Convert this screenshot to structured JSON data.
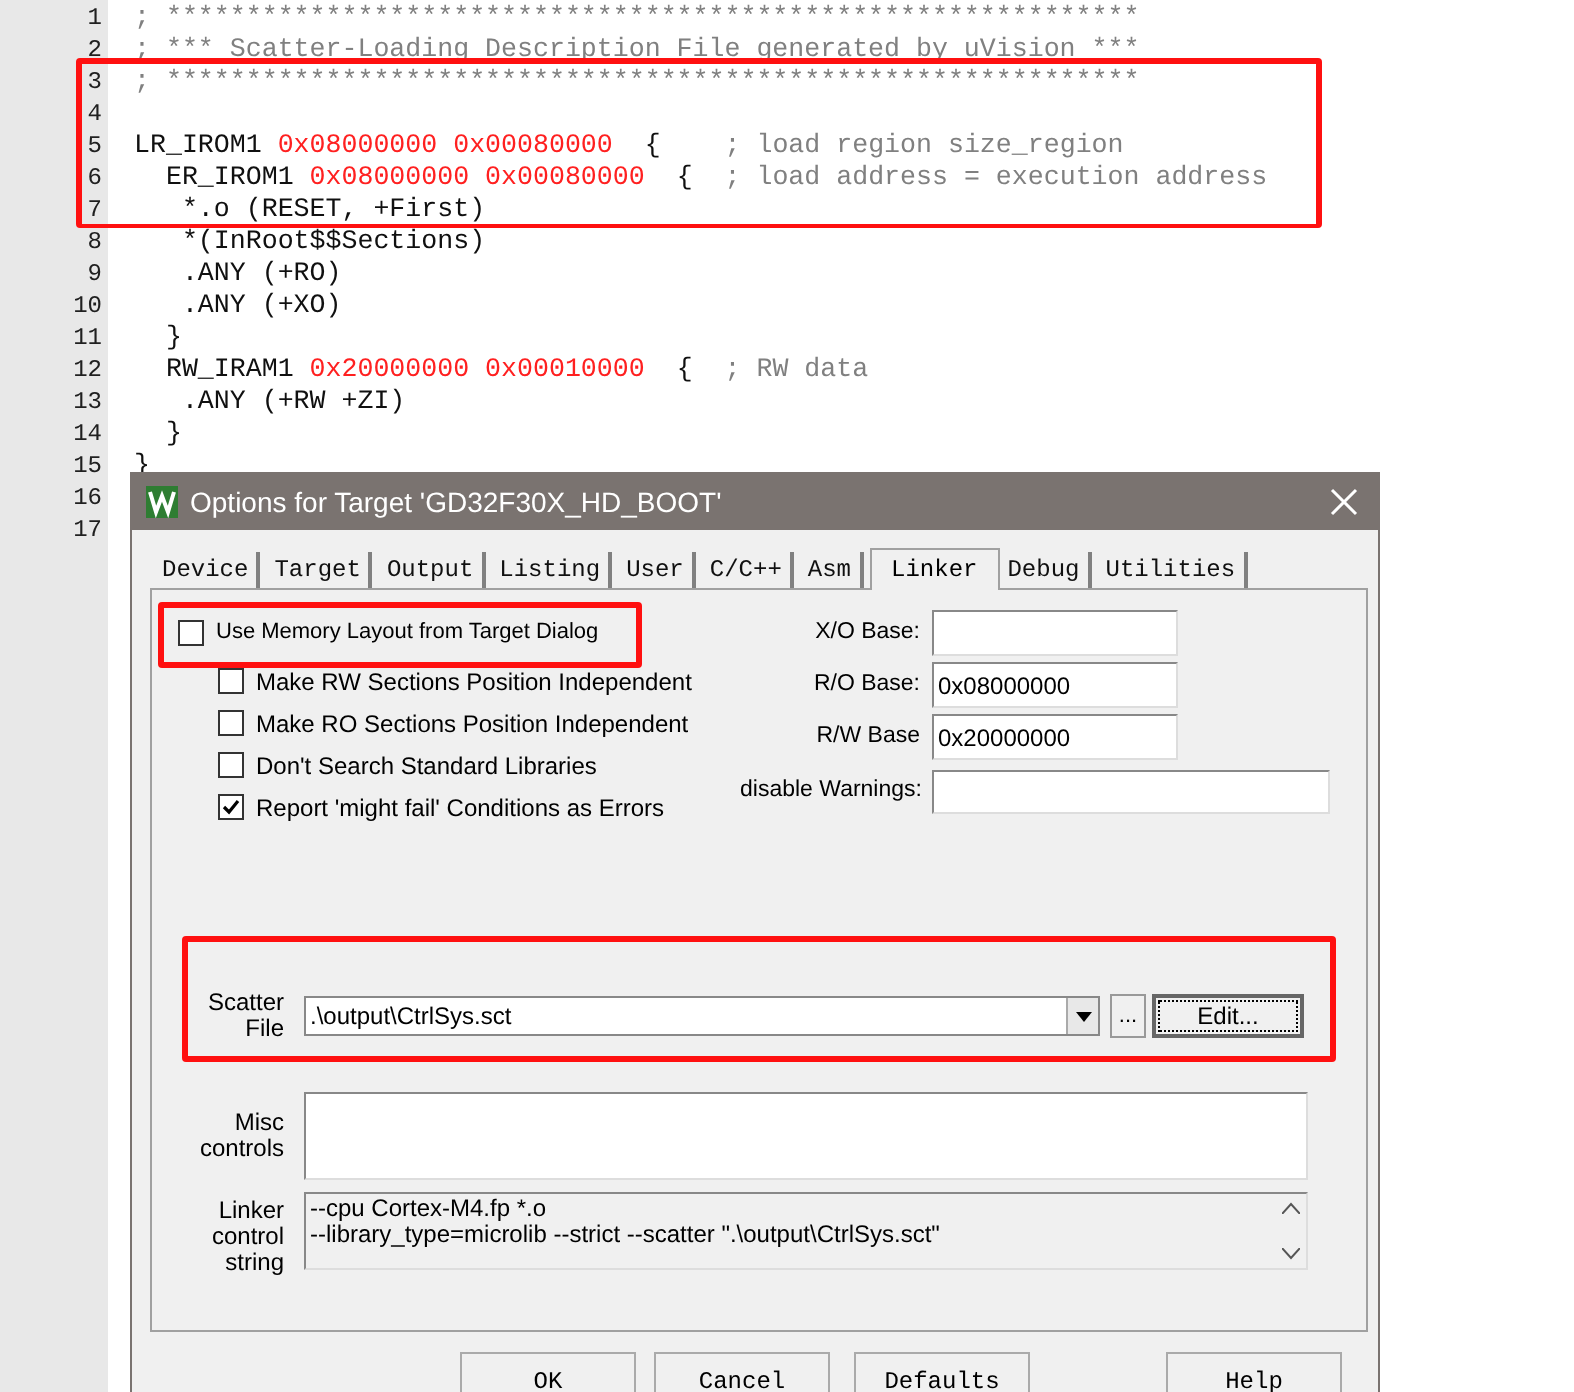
{
  "editor": {
    "lines": [
      {
        "number": "1",
        "segments": [
          {
            "kind": "comment",
            "text": "; *************************************************************"
          }
        ]
      },
      {
        "number": "2",
        "segments": [
          {
            "kind": "comment",
            "text": "; *** Scatter-Loading Description File generated by uVision ***"
          }
        ]
      },
      {
        "number": "3",
        "segments": [
          {
            "kind": "comment",
            "text": "; *************************************************************"
          }
        ]
      },
      {
        "number": "4"
      },
      {
        "number": "5",
        "segments": [
          {
            "kind": "code",
            "text": "LR_IROM1 "
          },
          {
            "kind": "number",
            "text": "0x08000000 0x00080000"
          },
          {
            "kind": "code",
            "text": "  {    "
          },
          {
            "kind": "comment",
            "text": "; load region size_region"
          }
        ]
      },
      {
        "number": "6",
        "segments": [
          {
            "kind": "code",
            "text": "  ER_IROM1 "
          },
          {
            "kind": "number",
            "text": "0x08000000 0x00080000"
          },
          {
            "kind": "code",
            "text": "  {  "
          },
          {
            "kind": "comment",
            "text": "; load address = execution address"
          }
        ]
      },
      {
        "number": "7",
        "segments": [
          {
            "kind": "code",
            "text": "   *.o (RESET, +First)"
          }
        ]
      },
      {
        "number": "8",
        "segments": [
          {
            "kind": "code",
            "text": "   *(InRoot$$Sections)"
          }
        ]
      },
      {
        "number": "9",
        "segments": [
          {
            "kind": "code",
            "text": "   .ANY (+RO)"
          }
        ]
      },
      {
        "number": "10",
        "segments": [
          {
            "kind": "code",
            "text": "   .ANY (+XO)"
          }
        ]
      },
      {
        "number": "11",
        "segments": [
          {
            "kind": "code",
            "text": "  }"
          }
        ]
      },
      {
        "number": "12",
        "segments": [
          {
            "kind": "code",
            "text": "  RW_IRAM1 "
          },
          {
            "kind": "number",
            "text": "0x20000000 0x00010000"
          },
          {
            "kind": "code",
            "text": "  {  "
          },
          {
            "kind": "comment",
            "text": "; RW data"
          }
        ]
      },
      {
        "number": "13",
        "segments": [
          {
            "kind": "code",
            "text": "   .ANY (+RW +ZI)"
          }
        ]
      },
      {
        "number": "14",
        "segments": [
          {
            "kind": "code",
            "text": "  }"
          }
        ]
      },
      {
        "number": "15",
        "segments": [
          {
            "kind": "code",
            "text": "}"
          }
        ]
      },
      {
        "number": "16"
      },
      {
        "number": "17"
      }
    ]
  },
  "dialog": {
    "title": "Options for Target 'GD32F30X_HD_BOOT'",
    "tabs": [
      {
        "label": "Device",
        "selected": false
      },
      {
        "label": "Target",
        "selected": false
      },
      {
        "label": "Output",
        "selected": false
      },
      {
        "label": "Listing",
        "selected": false
      },
      {
        "label": "User",
        "selected": false
      },
      {
        "label": "C/C++",
        "selected": false
      },
      {
        "label": "Asm",
        "selected": false
      },
      {
        "label": "Linker",
        "selected": true
      },
      {
        "label": "Debug",
        "selected": false
      },
      {
        "label": "Utilities",
        "selected": false
      }
    ],
    "memory_layout_option": {
      "label": "Use Memory Layout from Target Dialog",
      "checked": false,
      "children": [
        {
          "label": "Make RW Sections Position Independent",
          "checked": false
        },
        {
          "label": "Make RO Sections Position Independent",
          "checked": false
        },
        {
          "label": "Don't Search Standard Libraries",
          "checked": false
        },
        {
          "label": "Report 'might fail' Conditions as Errors",
          "checked": true
        }
      ]
    },
    "bases": [
      {
        "label": "X/O Base:"
      },
      {
        "label": "R/O Base:",
        "value": "0x08000000"
      },
      {
        "label": "R/W Base",
        "value": "0x20000000"
      }
    ],
    "disable_warnings": {
      "label": "disable Warnings:"
    },
    "scatter_file": {
      "label": "Scatter File",
      "value": ".\\output\\CtrlSys.sct",
      "browse": "...",
      "edit": "Edit..."
    },
    "misc_controls": {
      "label": "Misc controls"
    },
    "linker_control_string": {
      "label": "Linker control string",
      "lines": [
        "--cpu Cortex-M4.fp *.o",
        "--library_type=microlib --strict --scatter \".\\output\\CtrlSys.sct\""
      ]
    },
    "buttons": [
      "OK",
      "Cancel",
      "Defaults",
      "Help"
    ]
  }
}
